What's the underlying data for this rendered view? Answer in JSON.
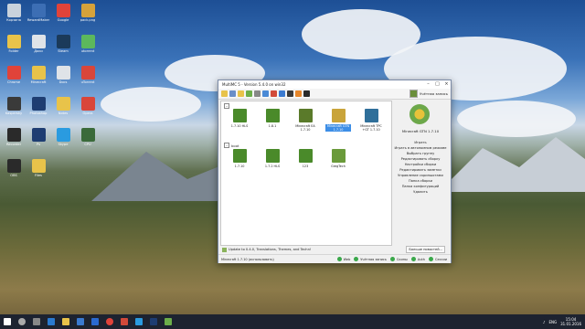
{
  "window": {
    "title": "MultiMC 5 - Version 5.4.0 on win32",
    "account": "Учётная запись"
  },
  "groups": [
    {
      "label": "",
      "collapse": "−"
    },
    {
      "label": "boot",
      "collapse": "−"
    }
  ],
  "instances_row1": [
    {
      "name": "1.7.10 HLS",
      "color": "#4a8a2a"
    },
    {
      "name": "1.8.1",
      "color": "#4a8a2a"
    },
    {
      "name": "Minecraft EA 1.7.10",
      "color": "#5a7a2a"
    },
    {
      "name": "Minecraft GTN 1.7.10",
      "color": "#c9a43a",
      "selected": true
    },
    {
      "name": "Minecraft TPC +GT 1.7.10",
      "color": "#2f6f9a"
    }
  ],
  "instances_row2": [
    {
      "name": "1.7.10",
      "color": "#4a8a2a"
    },
    {
      "name": "1.7.2 HLS",
      "color": "#4a8a2a"
    },
    {
      "name": "123",
      "color": "#4a8a2a"
    },
    {
      "name": "GregTech",
      "color": "#6a9a3a"
    }
  ],
  "side": {
    "instance_name": "Minecraft GTN 1.7.10",
    "actions": [
      "Играть",
      "Играть в автономном режиме",
      "Выбрать группу",
      "Редактировать сборку",
      "Настройки сборки",
      "Редактировать заметки",
      "Управление скриншотами",
      "Папка сборки",
      "Папка конфигураций",
      "Удалить"
    ]
  },
  "news": {
    "text": "Update to 0.4.0, Translations, Themes, and Techn!",
    "more": "Больше новостей..."
  },
  "status": {
    "left": "Minecraft 1.7.10 (использовать)",
    "items": [
      "Web",
      "Учётная запись",
      "Скины",
      "Auth",
      "Сессии"
    ]
  },
  "desktop_icons": [
    {
      "label": "Корзина",
      "color": "#c9d2dc"
    },
    {
      "label": "RewardMaker",
      "color": "#3c6eb4"
    },
    {
      "label": "Google",
      "color": "#e0433a"
    },
    {
      "label": "pack.png",
      "color": "#d6a23a"
    },
    {
      "label": "Folder",
      "color": "#e8c34a"
    },
    {
      "label": "Доки",
      "color": "#dfe3e8"
    },
    {
      "label": "Steam",
      "color": "#1b3a5a"
    },
    {
      "label": "utorrent",
      "color": "#5cb85c"
    },
    {
      "label": "Chrome",
      "color": "#e0433a"
    },
    {
      "label": "Minecraft",
      "color": "#e8c34a"
    },
    {
      "label": "Docs",
      "color": "#dfe3e8"
    },
    {
      "label": "uTorrent",
      "color": "#d9463a"
    },
    {
      "label": "Kaspersky",
      "color": "#3a3a3a"
    },
    {
      "label": "Photoshop",
      "color": "#1e3d72"
    },
    {
      "label": "Notes",
      "color": "#e8c34a"
    },
    {
      "label": "Opera",
      "color": "#d9463a"
    },
    {
      "label": "Recorder",
      "color": "#2a2a2a"
    },
    {
      "label": "Ps",
      "color": "#1e3d72"
    },
    {
      "label": "Skype",
      "color": "#2a9be0"
    },
    {
      "label": "CPU",
      "color": "#3a6a3a"
    },
    {
      "label": "OBS",
      "color": "#2a2a2a"
    },
    {
      "label": "Files",
      "color": "#e8c34a"
    }
  ],
  "taskbar": {
    "lang": "ENG",
    "time": "15:04",
    "date": "31.01.2016"
  }
}
